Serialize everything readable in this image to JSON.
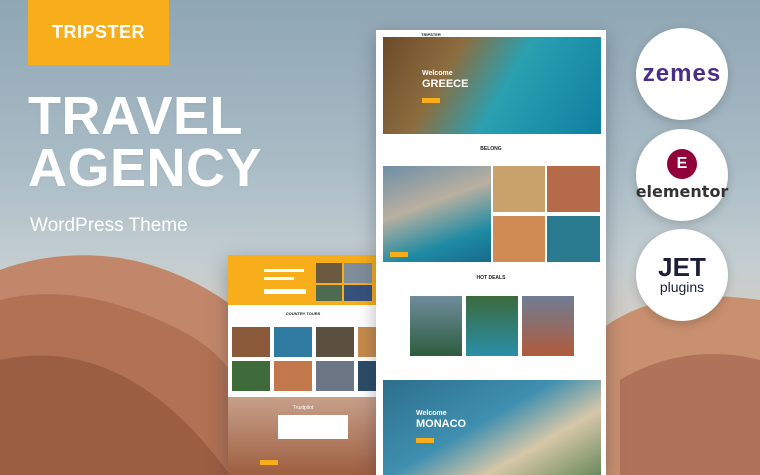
{
  "brand": {
    "name": "TRIPSTER"
  },
  "hero": {
    "title_line1": "TRAVEL",
    "title_line2": "AGENCY",
    "subtitle": "WordPress Theme"
  },
  "mockup_main": {
    "logo": "TRIPSTER",
    "hero_kicker": "Welcome",
    "hero_title": "GREECE",
    "section1_title": "BELONG",
    "section2_title": "HOT DEALS",
    "footer_kicker": "Welcome",
    "footer_title": "MONACO"
  },
  "mockup_left": {
    "section_title": "COUNTRY TOURS",
    "review_brand": "Trustpilot"
  },
  "partners": {
    "zemes": "zemes",
    "elementor_icon": "E",
    "elementor": "elementor",
    "jet": "JET",
    "jet_sub": "plugins"
  },
  "colors": {
    "accent": "#f8ad1b",
    "zemes": "#4a2c8a",
    "elementor": "#92003b"
  }
}
